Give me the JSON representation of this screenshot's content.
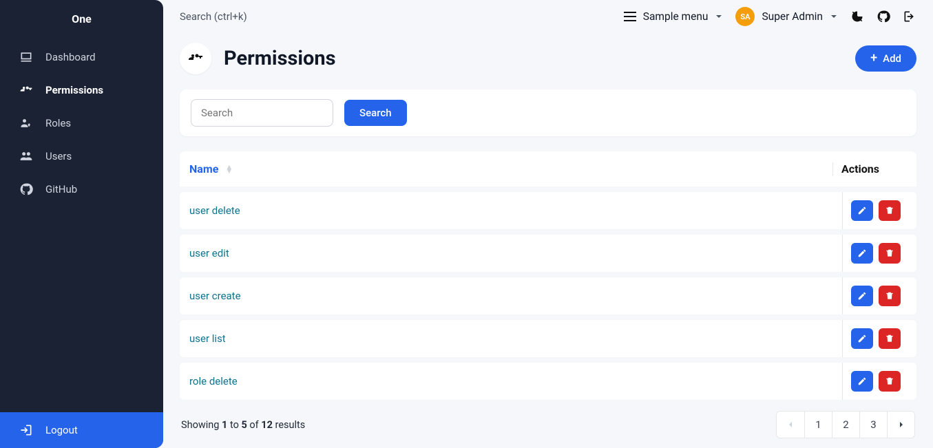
{
  "brand": "One",
  "sidebar": {
    "items": [
      {
        "label": "Dashboard",
        "icon": "dashboard"
      },
      {
        "label": "Permissions",
        "icon": "permissions",
        "active": true
      },
      {
        "label": "Roles",
        "icon": "roles"
      },
      {
        "label": "Users",
        "icon": "users"
      },
      {
        "label": "GitHub",
        "icon": "github"
      }
    ],
    "logout_label": "Logout"
  },
  "topbar": {
    "search_hint": "Search (ctrl+k)",
    "sample_menu_label": "Sample menu",
    "avatar_initials": "SA",
    "user_name": "Super Admin"
  },
  "page": {
    "title": "Permissions",
    "add_label": "Add"
  },
  "search": {
    "placeholder": "Search",
    "button_label": "Search",
    "value": ""
  },
  "table": {
    "col_name": "Name",
    "col_actions": "Actions",
    "rows": [
      {
        "name": "user delete"
      },
      {
        "name": "user edit"
      },
      {
        "name": "user create"
      },
      {
        "name": "user list"
      },
      {
        "name": "role delete"
      }
    ]
  },
  "pagination": {
    "prefix": "Showing ",
    "from": "1",
    "mid1": " to ",
    "to": "5",
    "mid2": " of ",
    "total": "12",
    "suffix": " results",
    "pages": [
      "1",
      "2",
      "3"
    ]
  }
}
